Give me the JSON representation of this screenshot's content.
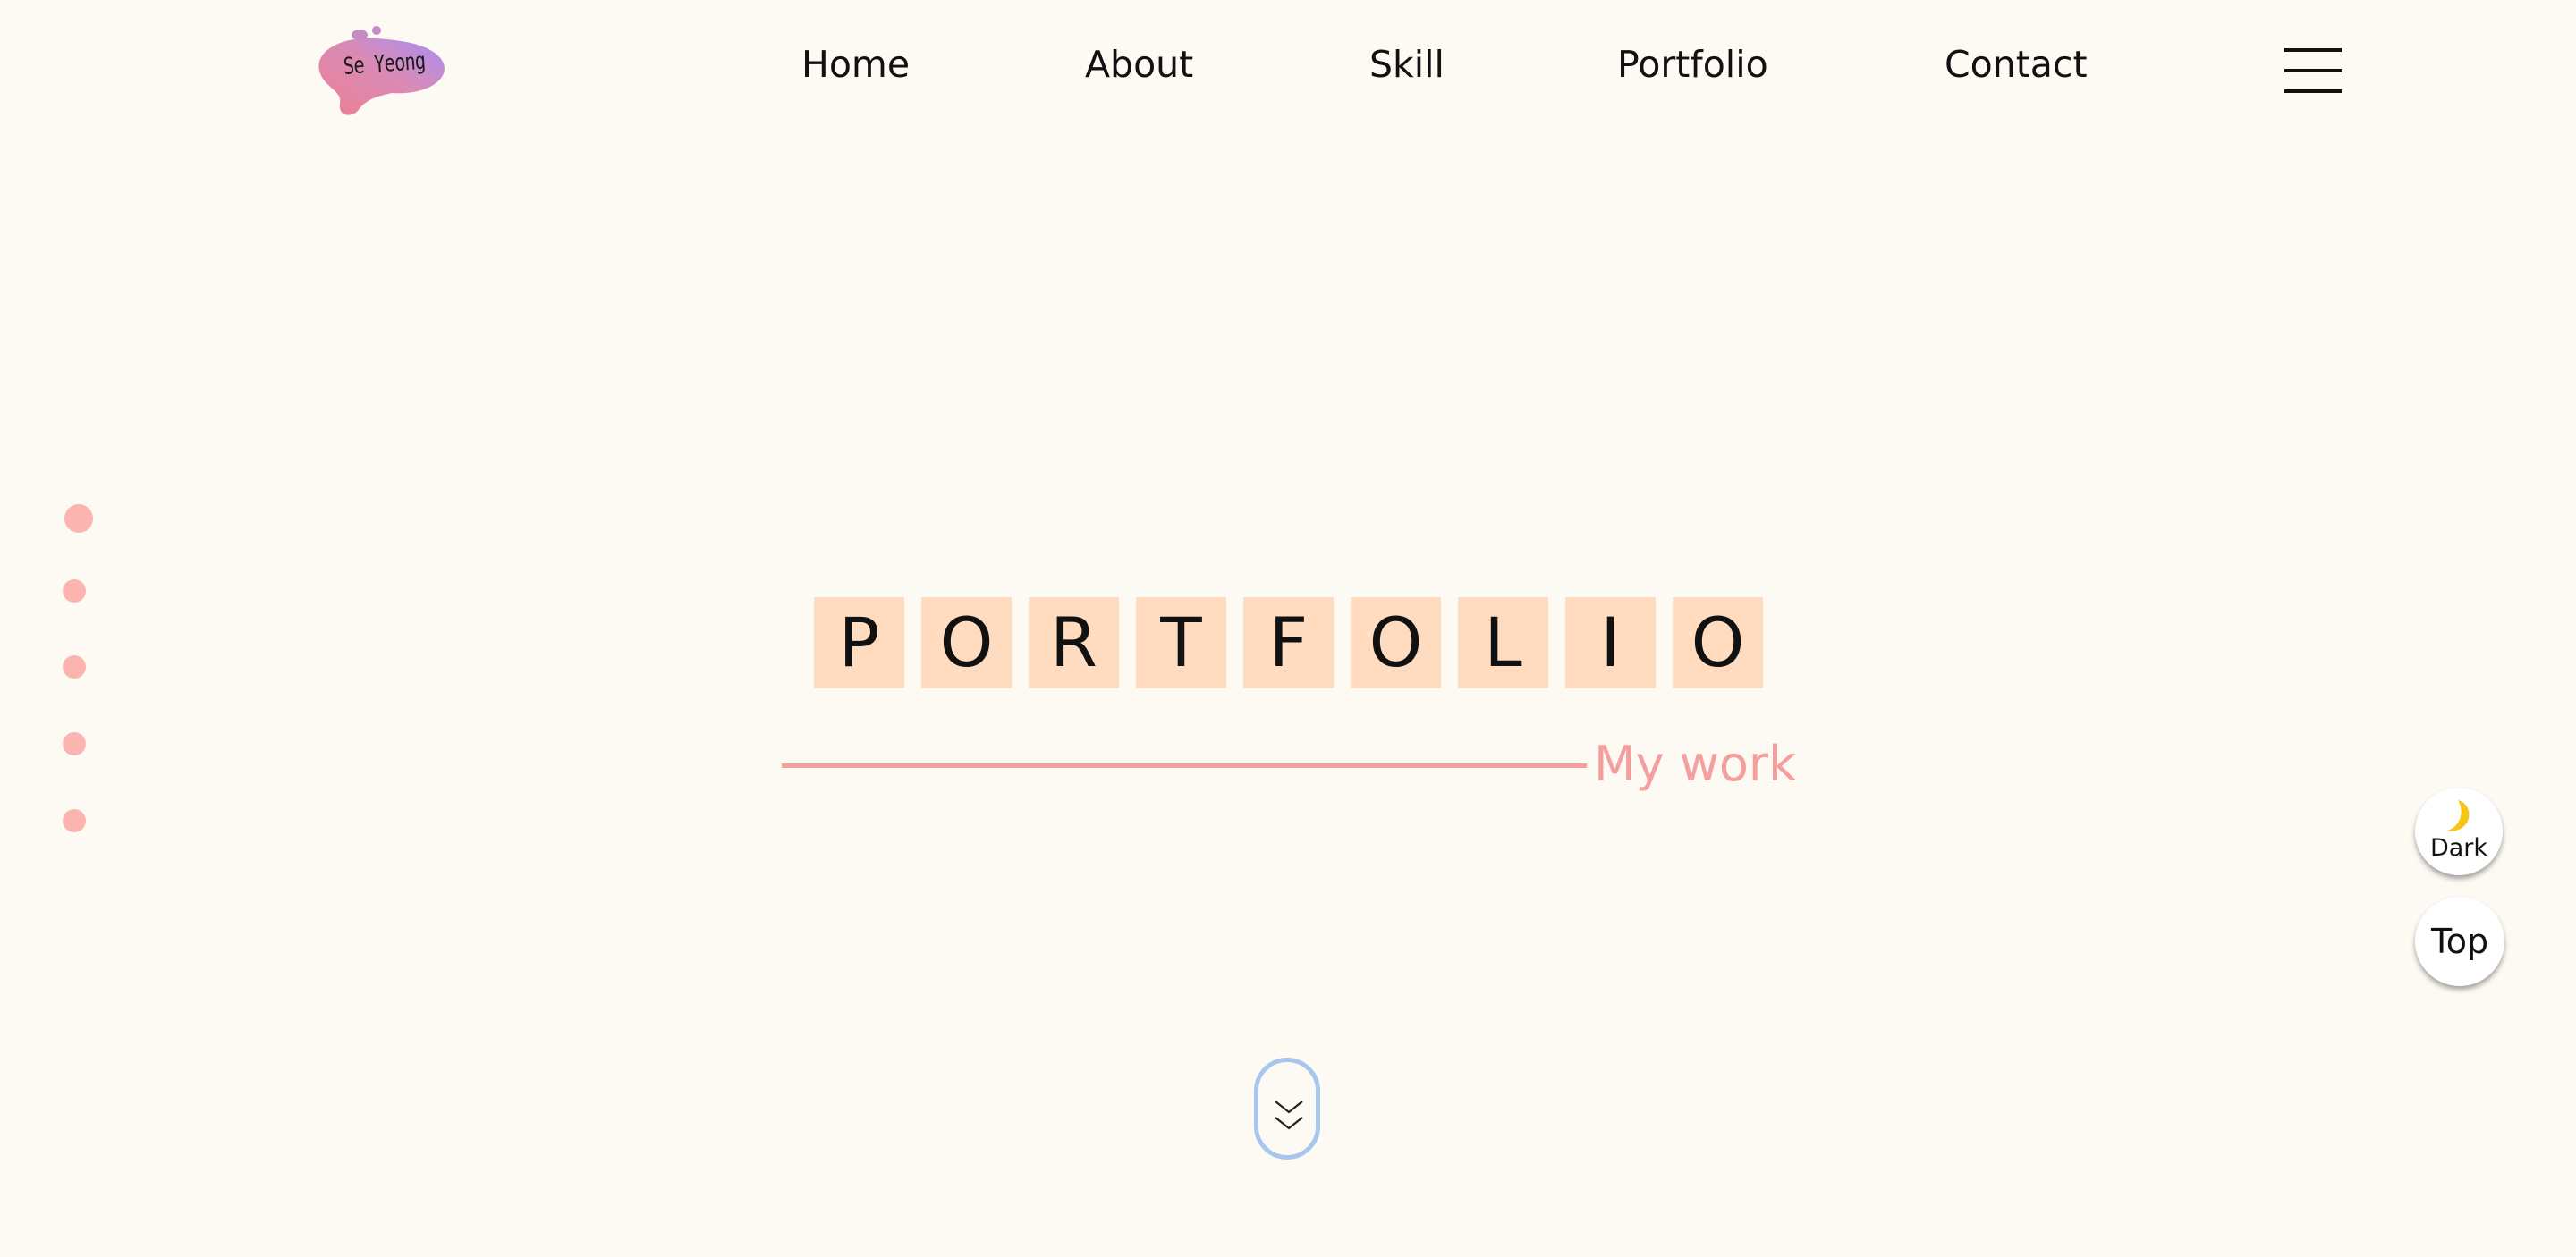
{
  "header": {
    "logo_text": "Se Yeong",
    "nav": [
      {
        "label": "Home"
      },
      {
        "label": "About"
      },
      {
        "label": "Skill"
      },
      {
        "label": "Portfolio"
      },
      {
        "label": "Contact"
      }
    ],
    "menu_icon": "hamburger-menu-icon"
  },
  "side_nav": {
    "dots": 5,
    "color": "#fbb4b0"
  },
  "hero": {
    "letters": [
      "P",
      "O",
      "R",
      "T",
      "F",
      "O",
      "L",
      "I",
      "O"
    ],
    "tile_color": "#ffdcbf",
    "subtitle": "My work",
    "accent_color": "#f59e9e"
  },
  "scroll_button": {
    "icon": "double-chevron-down-icon",
    "border_color": "#a7c7ef"
  },
  "floating": {
    "dark_label": "Dark",
    "dark_icon": "moon-icon",
    "top_label": "Top"
  }
}
